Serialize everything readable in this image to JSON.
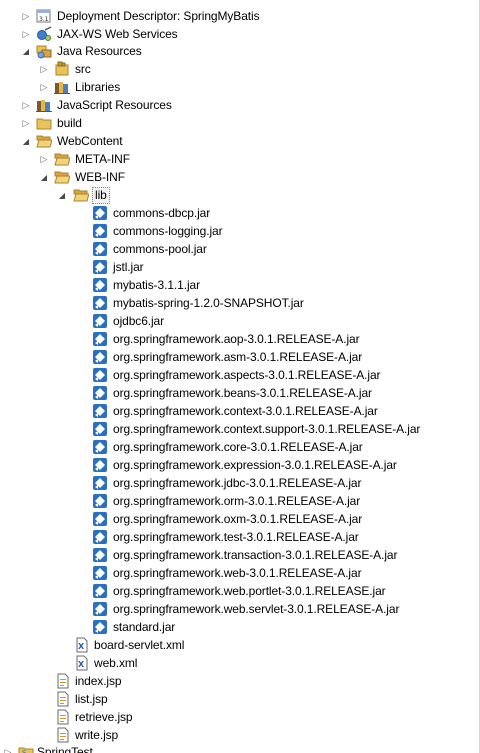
{
  "tree": {
    "deployment_descriptor": "Deployment Descriptor: SpringMyBatis",
    "jaxws": "JAX-WS Web Services",
    "java_resources": "Java Resources",
    "src": "src",
    "libraries": "Libraries",
    "javascript_resources": "JavaScript Resources",
    "build": "build",
    "webcontent": "WebContent",
    "metainf": "META-INF",
    "webinf": "WEB-INF",
    "lib": "lib",
    "jars": [
      "commons-dbcp.jar",
      "commons-logging.jar",
      "commons-pool.jar",
      "jstl.jar",
      "mybatis-3.1.1.jar",
      "mybatis-spring-1.2.0-SNAPSHOT.jar",
      "ojdbc6.jar",
      "org.springframework.aop-3.0.1.RELEASE-A.jar",
      "org.springframework.asm-3.0.1.RELEASE-A.jar",
      "org.springframework.aspects-3.0.1.RELEASE-A.jar",
      "org.springframework.beans-3.0.1.RELEASE-A.jar",
      "org.springframework.context-3.0.1.RELEASE-A.jar",
      "org.springframework.context.support-3.0.1.RELEASE-A.jar",
      "org.springframework.core-3.0.1.RELEASE-A.jar",
      "org.springframework.expression-3.0.1.RELEASE-A.jar",
      "org.springframework.jdbc-3.0.1.RELEASE-A.jar",
      "org.springframework.orm-3.0.1.RELEASE-A.jar",
      "org.springframework.oxm-3.0.1.RELEASE-A.jar",
      "org.springframework.test-3.0.1.RELEASE-A.jar",
      "org.springframework.transaction-3.0.1.RELEASE-A.jar",
      "org.springframework.web-3.0.1.RELEASE-A.jar",
      "org.springframework.web.portlet-3.0.1.RELEASE.jar",
      "org.springframework.web.servlet-3.0.1.RELEASE-A.jar",
      "standard.jar"
    ],
    "board_servlet": "board-servlet.xml",
    "web_xml": "web.xml",
    "index_jsp": "index.jsp",
    "list_jsp": "list.jsp",
    "retrieve_jsp": "retrieve.jsp",
    "write_jsp": "write.jsp",
    "spring_test": "SpringTest"
  },
  "icons": {
    "deployment_descriptor": "deployment-descriptor-icon",
    "jaxws": "web-services-icon",
    "java_resources": "java-resources-icon",
    "src": "package-folder-icon",
    "libraries": "libraries-icon",
    "javascript_resources": "javascript-resources-icon",
    "folder": "folder-icon",
    "open_folder": "open-folder-icon",
    "jar": "jar-icon",
    "xml": "xml-file-icon",
    "jsp": "jsp-file-icon",
    "project": "project-icon"
  },
  "colors": {
    "folder": "#e8c35a",
    "jar_blue": "#2a6fc0",
    "twisty": "#6b6b6b"
  }
}
